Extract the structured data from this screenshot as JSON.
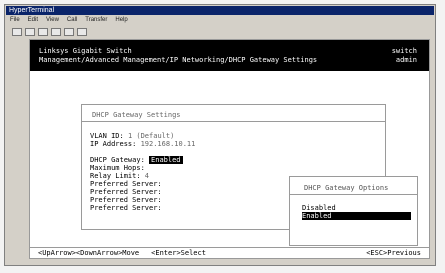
{
  "window": {
    "title": "HyperTerminal",
    "menu": [
      "File",
      "Edit",
      "View",
      "Call",
      "Transfer",
      "Help"
    ],
    "toolbar_icons": [
      "new-icon",
      "open-icon",
      "call-icon",
      "disconnect-icon",
      "send-icon",
      "properties-icon"
    ]
  },
  "terminal": {
    "header": {
      "device": "Linksys Gigabit Switch",
      "path": "Management/Advanced Management/IP Networking/DHCP Gateway Settings",
      "right1": "switch",
      "right2": "admin"
    },
    "panel": {
      "title": "DHCP Gateway Settings",
      "fields": [
        {
          "label": "VLAN ID:",
          "value": "1 (Default)"
        },
        {
          "label": "IP Address:",
          "value": "192.168.10.11"
        },
        {
          "label": "DHCP Gateway:",
          "value": "Enabled"
        },
        {
          "label": "Maximum Hops:",
          "value": ""
        },
        {
          "label": "Relay Limit:",
          "value": "4"
        },
        {
          "label": "Preferred Server:",
          "value": ""
        },
        {
          "label": "Preferred Server:",
          "value": ""
        },
        {
          "label": "Preferred Server:",
          "value": ""
        },
        {
          "label": "Preferred Server:",
          "value": ""
        }
      ]
    },
    "popup": {
      "title": "DHCP Gateway Options",
      "options": [
        "Disabled",
        "Enabled"
      ],
      "selected": "Enabled"
    },
    "footer": {
      "nav": "<UpArrow><DownArrow>Move",
      "enter": "<Enter>Select",
      "esc": "<ESC>Previous"
    }
  }
}
